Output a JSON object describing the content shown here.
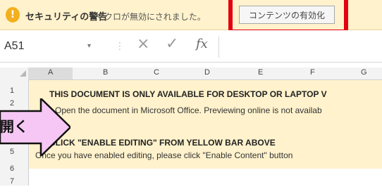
{
  "security_bar": {
    "title": "セキュリティの警告",
    "message": "マクロが無効にされました。",
    "button_label": "コンテンツの有効化",
    "icon": "warning-exclamation-icon"
  },
  "formula_bar": {
    "name_box": "A51",
    "cancel_icon": "×",
    "enter_icon": "✓",
    "fx_icon": "fx"
  },
  "grid": {
    "columns": [
      "A",
      "B",
      "C",
      "D",
      "E",
      "F",
      "G"
    ],
    "rows": [
      "1",
      "2",
      "3",
      "4",
      "5",
      "6",
      "7"
    ]
  },
  "content": {
    "line1": "THIS DOCUMENT IS ONLY AVAILABLE FOR DESKTOP OR LAPTOP V",
    "line2": "Open the document in Microsoft Office. Previewing online is not availab",
    "line3": "CLICK \"ENABLE EDITING\" FROM YELLOW BAR ABOVE",
    "line4": "Once you have enabled editing, please click \"Enable Content\" button",
    "bottom": "　　"
  },
  "annotation": {
    "arrow_label": "開く",
    "highlight_color": "#e3000f",
    "arrow_fill": "#f6c7f4"
  }
}
